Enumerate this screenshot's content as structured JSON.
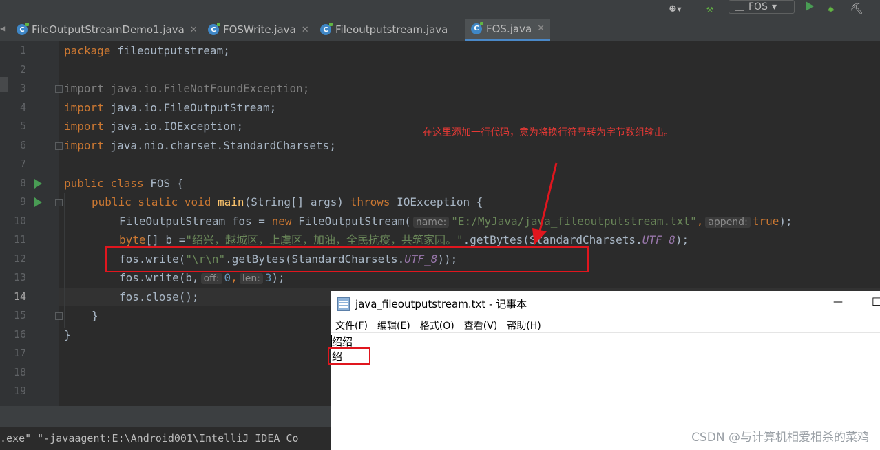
{
  "toolbar": {
    "run_config": "FOS"
  },
  "tabs": [
    {
      "label": "FileOutputStreamDemo1.java",
      "active": false
    },
    {
      "label": "FOSWrite.java",
      "active": false
    },
    {
      "label": "Fileoutputstream.java",
      "active": false
    },
    {
      "label": "FOS.java",
      "active": true
    }
  ],
  "line_numbers": [
    "1",
    "2",
    "3",
    "4",
    "5",
    "6",
    "7",
    "8",
    "9",
    "10",
    "11",
    "12",
    "13",
    "14",
    "15",
    "16",
    "17",
    "18",
    "19"
  ],
  "code": {
    "l1_kw": "package",
    "l1_rest": " fileoutputstream;",
    "l3_kw": "import",
    "l3_rest": " java.io.FileNotFoundException;",
    "l4_kw": "import",
    "l4_rest": " java.io.FileOutputStream;",
    "l5_kw": "import",
    "l5_rest": " java.io.IOException;",
    "l6_kw": "import",
    "l6_rest": " java.nio.charset.StandardCharsets;",
    "l8_kw": "public class",
    "l8_rest": " FOS {",
    "l9_kw": "public static void",
    "l9_fn": "main",
    "l9_mid": "(String[] args) ",
    "l9_kw2": "throws",
    "l9_rest": " IOException {",
    "l10_a": "FileOutputStream fos = ",
    "l10_kw": "new",
    "l10_b": " FileOutputStream(",
    "l10_hint1": "name:",
    "l10_str": "\"E:/MyJava/java_fileoutputstream.txt\"",
    "l10_c": ",",
    "l10_hint2": "append:",
    "l10_kw2": "true",
    "l10_d": ");",
    "l11_kw": "byte",
    "l11_a": "[] b =",
    "l11_str": "\"绍兴，越城区，上虞区，加油，全民抗疫，共筑家园。\"",
    "l11_b": ".getBytes(StandardCharsets.",
    "l11_it": "UTF_8",
    "l11_c": ");",
    "l12_a": "fos.write(",
    "l12_str": "\"\\r\\n\"",
    "l12_b": ".getBytes(StandardCharsets.",
    "l12_it": "UTF_8",
    "l12_c": "));",
    "l13_a": "fos.write(b,",
    "l13_hint1": "off:",
    "l13_n1": "0",
    "l13_b": ",",
    "l13_hint2": "len:",
    "l13_n2": "3",
    "l13_c": ");",
    "l14": "fos.close();",
    "l15": "}",
    "l16": "}"
  },
  "annotation": "在这里添加一行代码，意为将换行符号转为字节数组输出。",
  "console": ".exe\" \"-javaagent:E:\\Android001\\IntelliJ IDEA Co",
  "notepad": {
    "title": "java_fileoutputstream.txt - 记事本",
    "minimize": "—",
    "maximize": "☐",
    "menu": [
      "文件(F)",
      "编辑(E)",
      "格式(O)",
      "查看(V)",
      "帮助(H)"
    ],
    "lines": [
      "绍绍",
      "绍"
    ]
  },
  "watermark": "CSDN @与计算机相爱相杀的菜鸡"
}
